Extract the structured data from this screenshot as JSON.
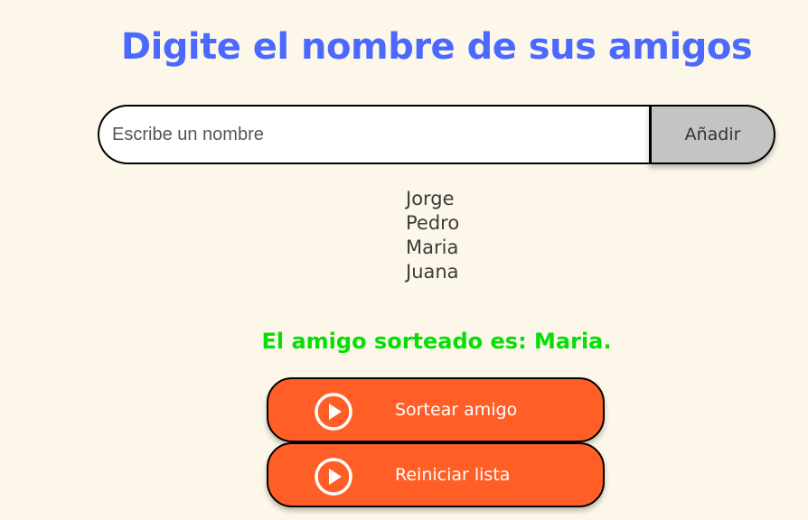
{
  "header": {
    "title": "Digite el nombre de sus amigos"
  },
  "input": {
    "placeholder": "Escribe un nombre",
    "value": "",
    "add_label": "Añadir"
  },
  "friends": [
    "Jorge",
    "Pedro",
    "Maria",
    "Juana"
  ],
  "result": {
    "text": "El amigo sorteado es: Maria."
  },
  "buttons": {
    "draw": {
      "label": "Sortear amigo",
      "icon": "play-icon"
    },
    "reset": {
      "label": "Reiniciar lista",
      "icon": "play-icon"
    }
  },
  "colors": {
    "background": "#FDF7E9",
    "title": "#4B69FD",
    "result": "#05DF05",
    "button": "#FF5F27",
    "add_button": "#C4C4C4"
  }
}
